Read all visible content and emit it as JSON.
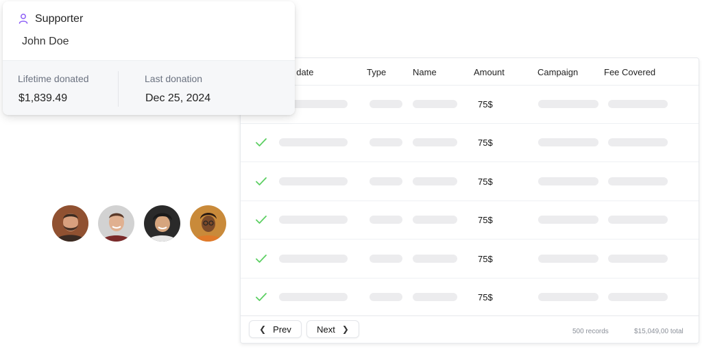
{
  "supporter_card": {
    "role": "Supporter",
    "name": "John Doe",
    "lifetime_label": "Lifetime donated",
    "lifetime_value": "$1,839.49",
    "last_label": "Last donation",
    "last_value": "Dec 25, 2024",
    "accent_color": "#8b5cf6"
  },
  "avatars": [
    {
      "icon": "avatar-bearded-man",
      "bg": "#8a5a3c"
    },
    {
      "icon": "avatar-smiling-man",
      "bg": "#c9c9c9"
    },
    {
      "icon": "avatar-young-man",
      "bg": "#2c2c2c"
    },
    {
      "icon": "avatar-woman-glasses",
      "bg": "#c98a3a"
    }
  ],
  "table": {
    "headers": {
      "date": "t date",
      "type": "Type",
      "name": "Name",
      "amount": "Amount",
      "campaign": "Campaign",
      "fee": "Fee Covered"
    },
    "rows": [
      {
        "amount": "75$",
        "check": false
      },
      {
        "amount": "75$",
        "check": true
      },
      {
        "amount": "75$",
        "check": true
      },
      {
        "amount": "75$",
        "check": true
      },
      {
        "amount": "75$",
        "check": true
      },
      {
        "amount": "75$",
        "check": true
      }
    ],
    "check_color": "#5ccf62"
  },
  "pager": {
    "prev_label": "Prev",
    "next_label": "Next",
    "records": "500 records",
    "total": "$15,049,00 total"
  }
}
